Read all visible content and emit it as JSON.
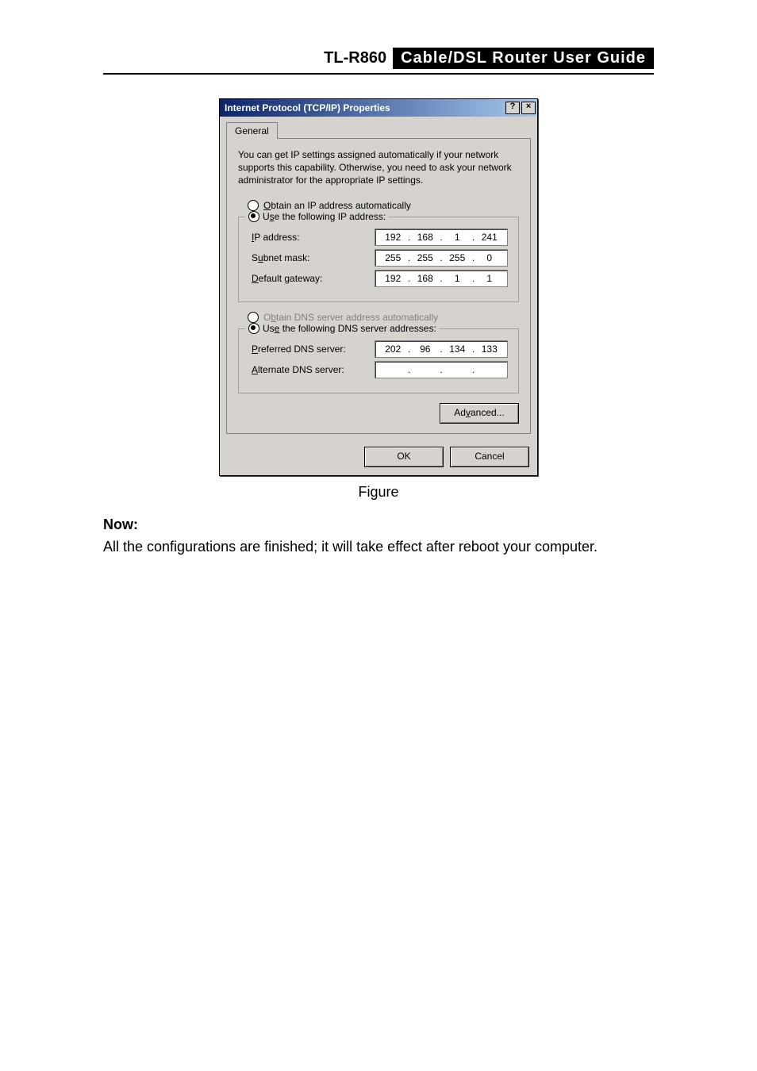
{
  "header": {
    "model": "TL-R860",
    "guide": "Cable/DSL  Router  User  Guide"
  },
  "dialog": {
    "title": "Internet Protocol (TCP/IP) Properties",
    "help_glyph": "?",
    "close_glyph": "×",
    "tab": "General",
    "description": "You can get IP settings assigned automatically if your network supports this capability. Otherwise, you need to ask your network administrator for the appropriate IP settings.",
    "ip_section": {
      "radio_auto": "btain an IP address automatically",
      "radio_manual": "e the following IP address:",
      "ip_label": "P address:",
      "ip": [
        "192",
        "168",
        "1",
        "241"
      ],
      "subnet_label": "bnet mask:",
      "subnet": [
        "255",
        "255",
        "255",
        "0"
      ],
      "gw_label": "efault gateway:",
      "gw": [
        "192",
        "168",
        "1",
        "1"
      ]
    },
    "dns_section": {
      "radio_auto": "tain DNS server address automatically",
      "radio_manual": "Us",
      "radio_manual_tail": " the following DNS server addresses:",
      "pref_label": "referred DNS server:",
      "pref": [
        "202",
        "96",
        "134",
        "133"
      ],
      "alt_label": "lternate DNS server:",
      "alt": [
        "",
        "",
        "",
        ""
      ]
    },
    "advanced": "Ad",
    "advanced_tail": "anced...",
    "ok": "OK",
    "cancel": "Cancel"
  },
  "caption": "Figure",
  "now_label": "Now:",
  "body_text": "All the configurations are finished; it will take effect after reboot your computer."
}
